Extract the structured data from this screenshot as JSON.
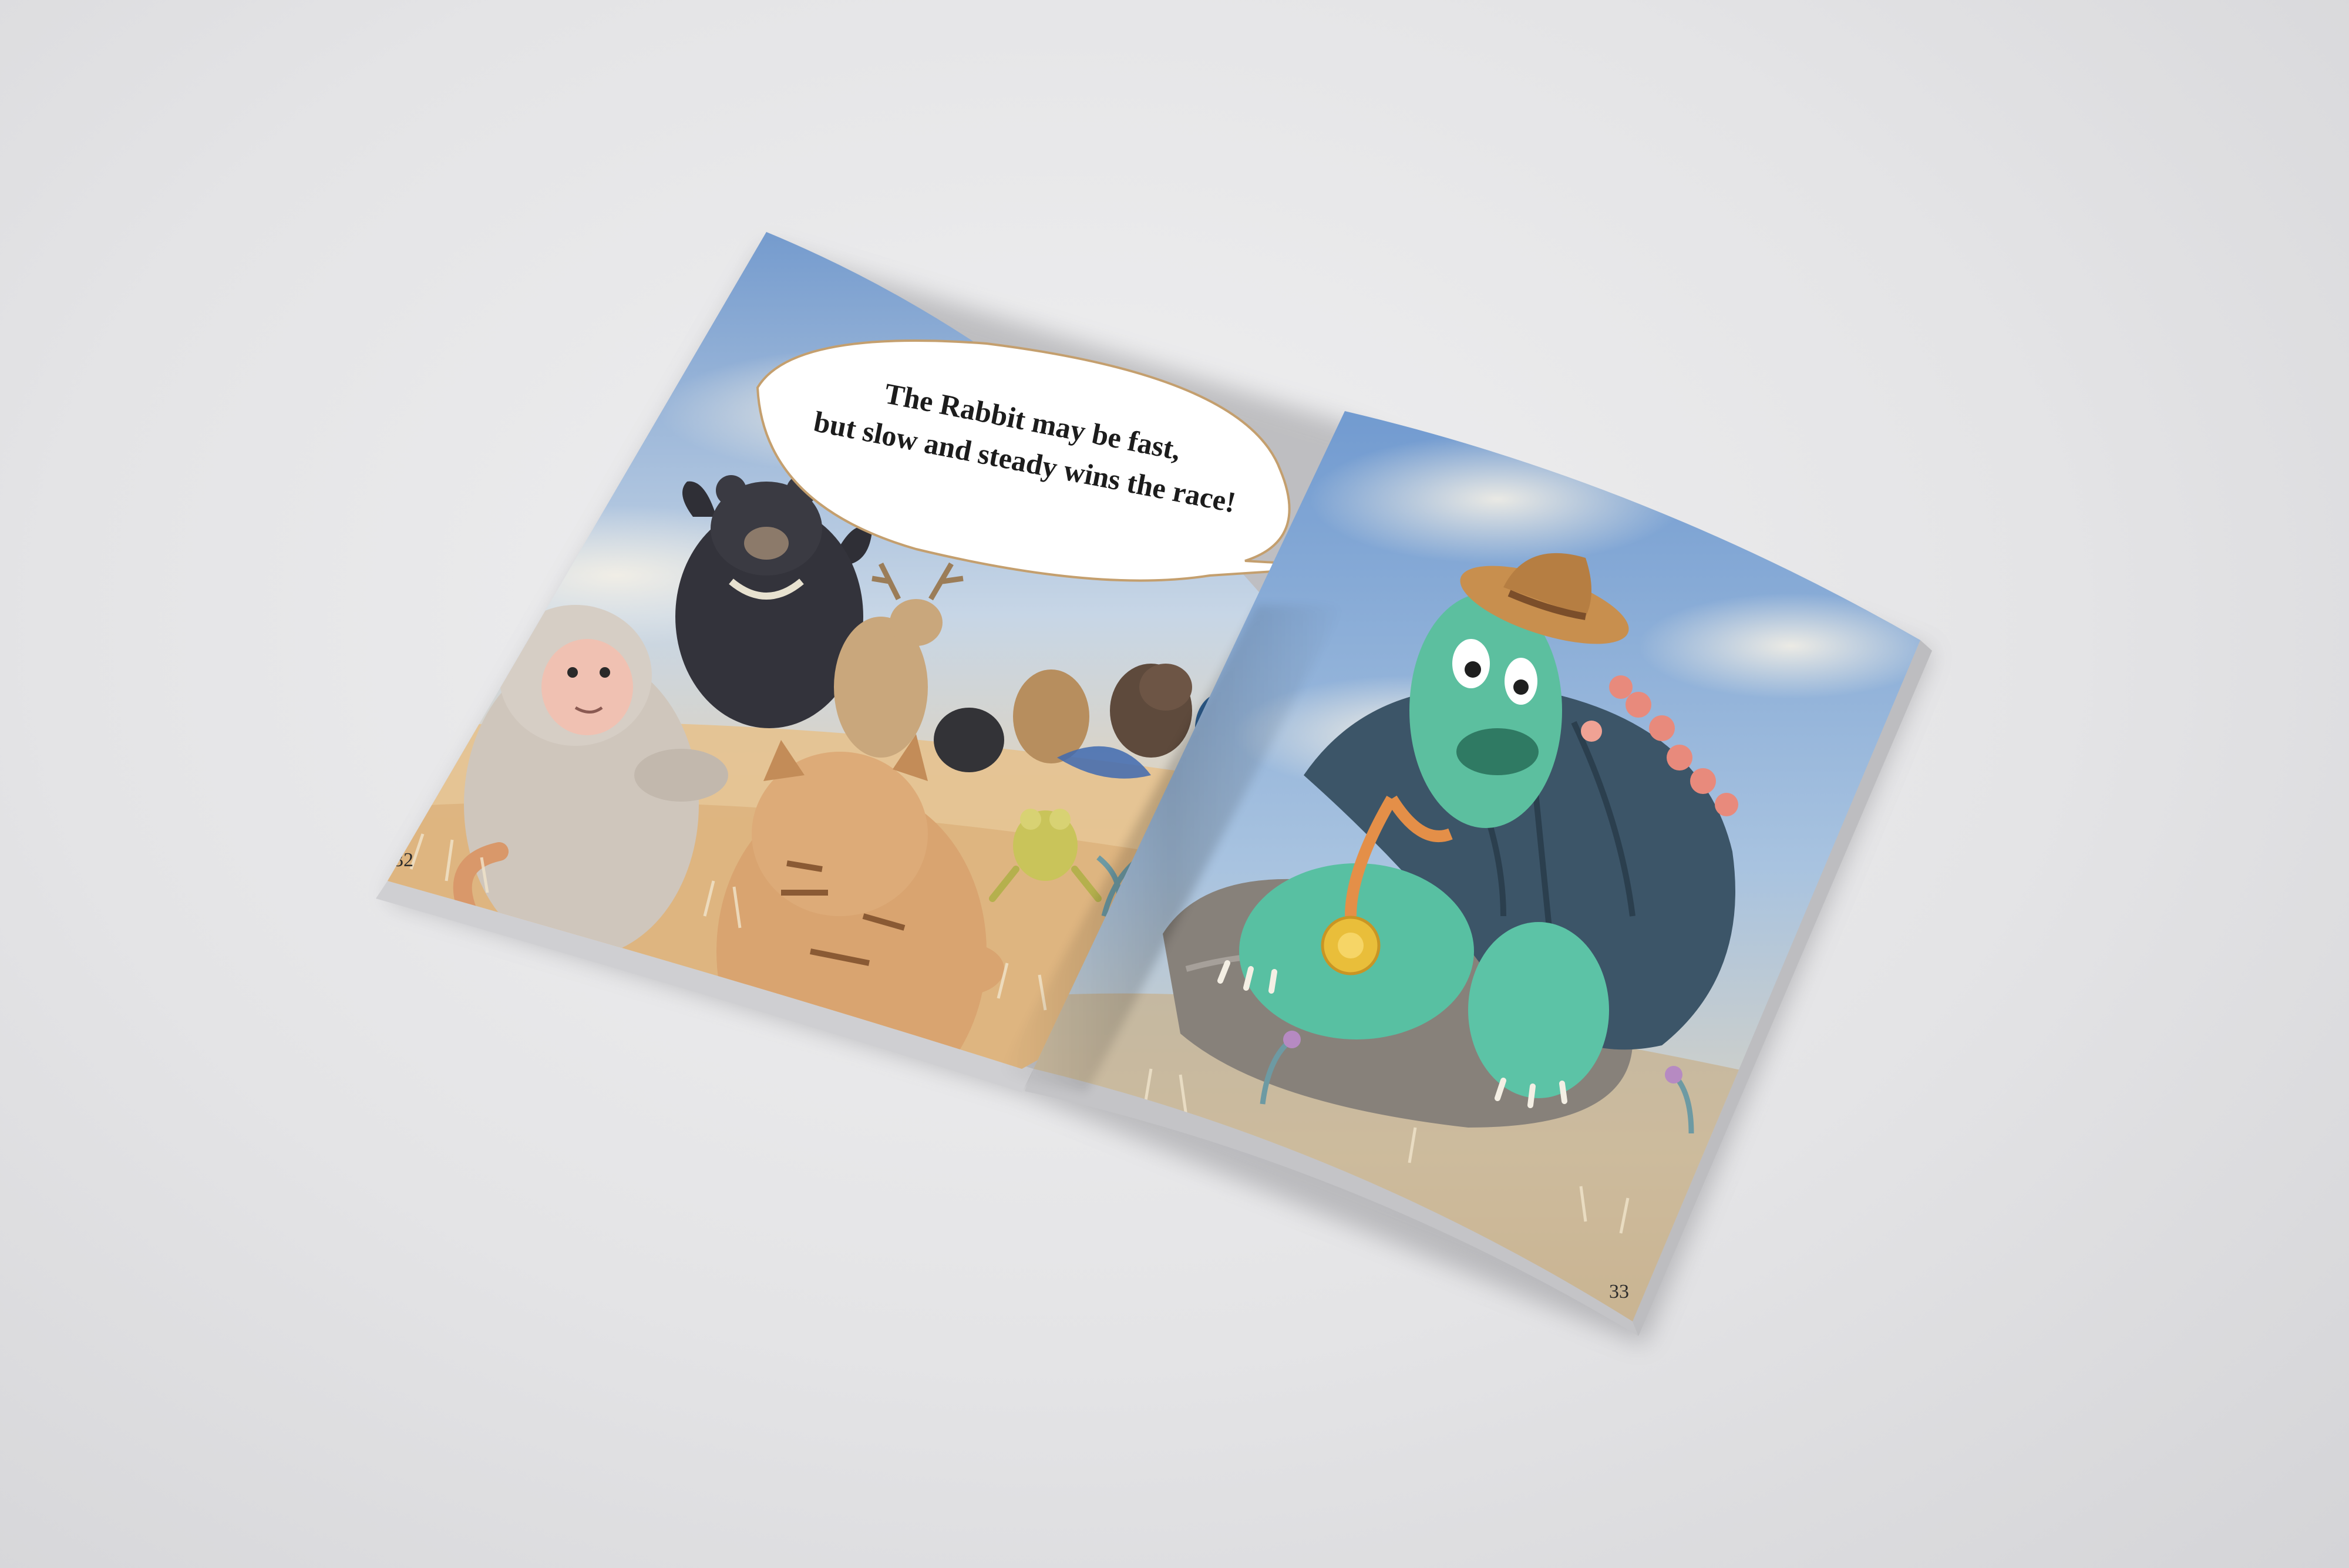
{
  "book": {
    "speech_bubble": {
      "line1": "The Rabbit may be fast,",
      "line2": "but slow and steady wins the race!"
    },
    "left_page_number": "32",
    "right_page_number": "33"
  },
  "illustration": {
    "left_page_characters": [
      "monkey",
      "black-bear",
      "deer",
      "mole",
      "flying-squirrel",
      "boar",
      "snail",
      "frog",
      "leopard-cat",
      "pheasant"
    ],
    "right_page_characters": [
      "tortoise"
    ],
    "tortoise_accessories": [
      "straw-hat",
      "flower-garland",
      "gold-medal"
    ]
  },
  "colors": {
    "background": "#e4e4e6",
    "sky": "#8fb4dd",
    "sand": "#e9c79a",
    "tortoise_skin": "#5cc3a6",
    "tortoise_shell": "#3e5a6e"
  }
}
